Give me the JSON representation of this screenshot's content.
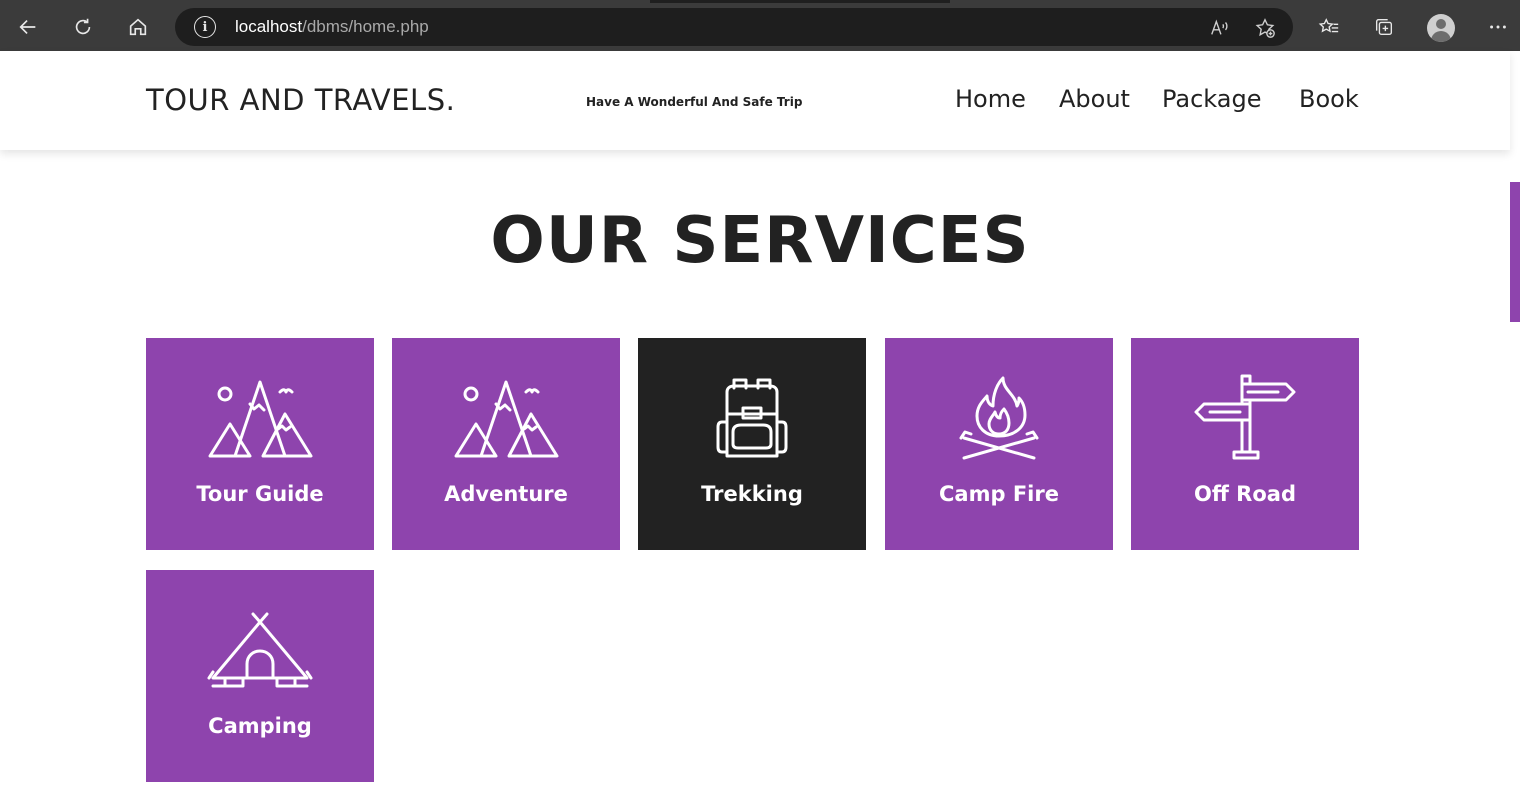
{
  "browser": {
    "url_host": "localhost",
    "url_path": "/dbms/home.php",
    "icons": [
      "back-arrow-icon",
      "refresh-icon",
      "home-icon",
      "info-icon",
      "read-aloud-icon",
      "add-favorite-icon",
      "favorites-icon",
      "collections-icon",
      "profile-avatar",
      "more-icon"
    ]
  },
  "header": {
    "brand": "TOUR AND TRAVELS.",
    "tagline": "Have A Wonderful And Safe Trip",
    "nav": [
      "Home",
      "About",
      "Package",
      "Book"
    ]
  },
  "services": {
    "title": "OUR SERVICES",
    "cards": [
      {
        "label": "Tour Guide",
        "icon": "mountains-icon",
        "highlighted": false
      },
      {
        "label": "Adventure",
        "icon": "mountains-icon",
        "highlighted": false
      },
      {
        "label": "Trekking",
        "icon": "backpack-icon",
        "highlighted": true
      },
      {
        "label": "Camp Fire",
        "icon": "campfire-icon",
        "highlighted": false
      },
      {
        "label": "Off Road",
        "icon": "signpost-icon",
        "highlighted": false
      },
      {
        "label": "Camping",
        "icon": "tent-icon",
        "highlighted": false
      }
    ]
  },
  "colors": {
    "accent": "#8e44ad",
    "highlight_card": "#222222",
    "text": "#222222",
    "browser_chrome": "#3b3b3b"
  }
}
